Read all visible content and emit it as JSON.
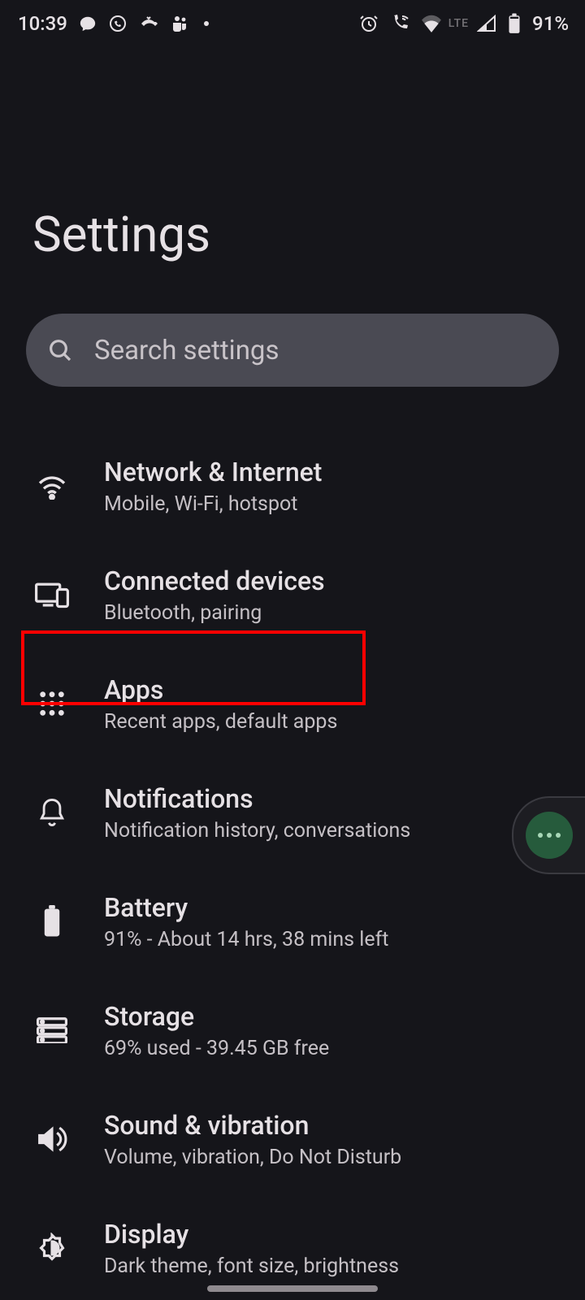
{
  "statusbar": {
    "time": "10:39",
    "battery": "91%",
    "network_label": "LTE"
  },
  "page": {
    "title": "Settings"
  },
  "search": {
    "placeholder": "Search settings"
  },
  "settings": [
    {
      "id": "network",
      "title": "Network & Internet",
      "subtitle": "Mobile, Wi-Fi, hotspot"
    },
    {
      "id": "connected",
      "title": "Connected devices",
      "subtitle": "Bluetooth, pairing"
    },
    {
      "id": "apps",
      "title": "Apps",
      "subtitle": "Recent apps, default apps",
      "highlighted": true
    },
    {
      "id": "notifications",
      "title": "Notifications",
      "subtitle": "Notification history, conversations"
    },
    {
      "id": "battery",
      "title": "Battery",
      "subtitle": "91% - About 14 hrs, 38 mins left"
    },
    {
      "id": "storage",
      "title": "Storage",
      "subtitle": "69% used - 39.45 GB free"
    },
    {
      "id": "sound",
      "title": "Sound & vibration",
      "subtitle": "Volume, vibration, Do Not Disturb"
    },
    {
      "id": "display",
      "title": "Display",
      "subtitle": "Dark theme, font size, brightness"
    }
  ]
}
